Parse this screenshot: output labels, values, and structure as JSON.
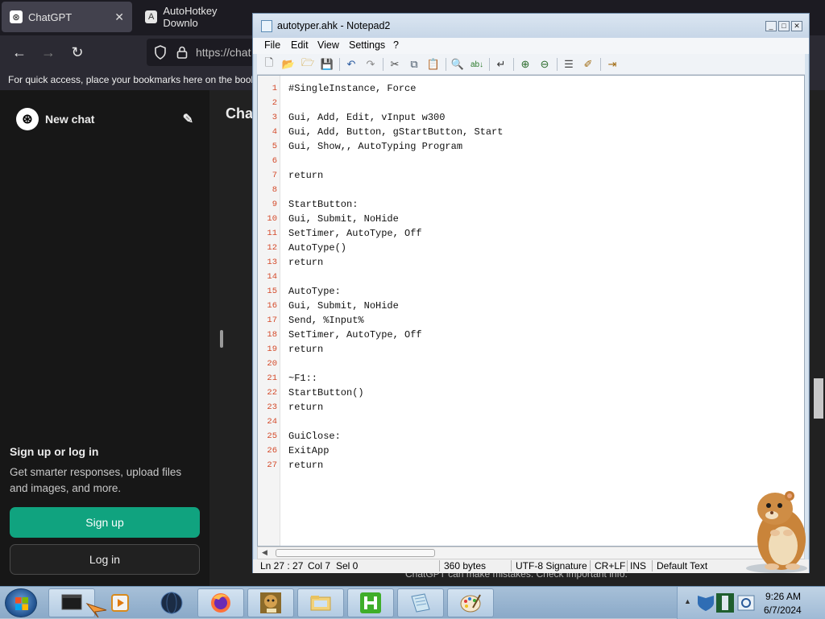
{
  "browser": {
    "tabs": [
      {
        "label": "ChatGPT",
        "active": true
      },
      {
        "label": "AutoHotkey Downlo",
        "active": false
      }
    ],
    "url": "https://chat",
    "bookmarks_hint": "For quick access, place your bookmarks here on the book",
    "sidebar": {
      "new_chat": "New chat",
      "signup_title": "Sign up or log in",
      "signup_desc": "Get smarter responses, upload files and images, and more.",
      "signup_button": "Sign up",
      "login_button": "Log in"
    },
    "main_title": "Cha",
    "disclaimer": "ChatGPT can make mistakes. Check important info.",
    "accent": "#10a37f"
  },
  "notepad": {
    "title": "autotyper.ahk - Notepad2",
    "menu": [
      "File",
      "Edit",
      "View",
      "Settings",
      "?"
    ],
    "lines": [
      {
        "n": "1",
        "text": "#SingleInstance, Force"
      },
      {
        "n": "2",
        "text": ""
      },
      {
        "n": "3",
        "text": "Gui, Add, Edit, vInput w300"
      },
      {
        "n": "4",
        "text": "Gui, Add, Button, gStartButton, Start"
      },
      {
        "n": "5",
        "text": "Gui, Show,, AutoTyping Program"
      },
      {
        "n": "6",
        "text": ""
      },
      {
        "n": "7",
        "text": "return"
      },
      {
        "n": "8",
        "text": ""
      },
      {
        "n": "9",
        "text": "StartButton:"
      },
      {
        "n": "10",
        "text": "Gui, Submit, NoHide"
      },
      {
        "n": "11",
        "text": "SetTimer, AutoType, Off"
      },
      {
        "n": "12",
        "text": "AutoType()"
      },
      {
        "n": "13",
        "text": "return"
      },
      {
        "n": "14",
        "text": ""
      },
      {
        "n": "15",
        "text": "AutoType:"
      },
      {
        "n": "16",
        "text": "Gui, Submit, NoHide"
      },
      {
        "n": "17",
        "text": "Send, %Input%"
      },
      {
        "n": "18",
        "text": "SetTimer, AutoType, Off"
      },
      {
        "n": "19",
        "text": "return"
      },
      {
        "n": "20",
        "text": ""
      },
      {
        "n": "21",
        "text": "~F1::"
      },
      {
        "n": "22",
        "text": "StartButton()"
      },
      {
        "n": "23",
        "text": "return"
      },
      {
        "n": "24",
        "text": ""
      },
      {
        "n": "25",
        "text": "GuiClose:"
      },
      {
        "n": "26",
        "text": "ExitApp"
      },
      {
        "n": "27",
        "text": "return"
      }
    ],
    "status": {
      "position": "Ln 27 : 27",
      "col": "Col 7",
      "sel": "Sel 0",
      "size": "360 bytes",
      "encoding": "UTF-8 Signature",
      "eol": "CR+LF",
      "ins": "INS",
      "scheme": "Default Text"
    },
    "line_number_color": "#d44a2a"
  },
  "taskbar": {
    "time": "9:26 AM",
    "date": "6/7/2024"
  }
}
